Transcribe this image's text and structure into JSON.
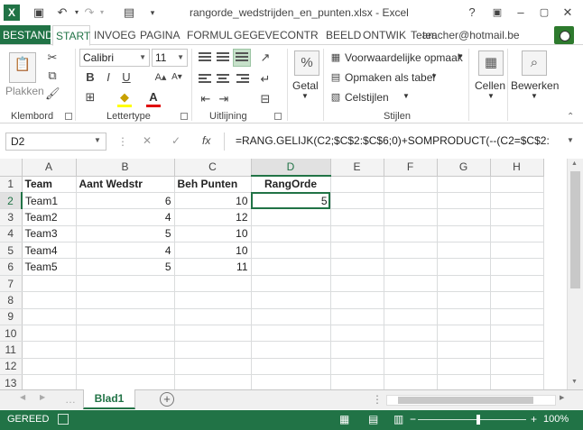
{
  "window": {
    "title": "rangorde_wedstrijden_en_punten.xlsx - Excel",
    "help": "?",
    "minimize": "–",
    "close": "✕"
  },
  "tabs": [
    "BESTAND",
    "START",
    "INVOEG",
    "PAGINA",
    "FORMUL",
    "GEGEVE",
    "CONTR",
    "BEELD",
    "ONTWIK",
    "Team"
  ],
  "account": "teacher@hotmail.be",
  "ribbon": {
    "paste_label": "Plakken",
    "clipboard_label": "Klembord",
    "font_name": "Calibri",
    "font_size": "11",
    "font_label": "Lettertype",
    "bold": "B",
    "italic": "I",
    "underline": "U",
    "alignment_label": "Uitlijning",
    "number_label": "Getal",
    "number_icon_text": "%",
    "cond_format": "Voorwaardelijke opmaak",
    "format_table": "Opmaken als tabel",
    "cell_styles": "Celstijlen",
    "styles_label": "Stijlen",
    "cells_label": "Cellen",
    "edit_label": "Bewerken"
  },
  "formula_bar": {
    "name_box": "D2",
    "cancel": "✕",
    "enter": "✓",
    "fx": "fx",
    "formula": "=RANG.GELIJK(C2;$C$2:$C$6;0)+SOMPRODUCT(--(C2=$C$2:"
  },
  "sheet": {
    "columns": [
      "A",
      "B",
      "C",
      "D",
      "E",
      "F",
      "G",
      "H"
    ],
    "rows": [
      [
        "Team",
        "Aant Wedstr",
        "Beh Punten",
        "RangOrde",
        "",
        "",
        "",
        ""
      ],
      [
        "Team1",
        "6",
        "10",
        "5",
        "",
        "",
        "",
        ""
      ],
      [
        "Team2",
        "4",
        "12",
        "",
        "",
        "",
        "",
        ""
      ],
      [
        "Team3",
        "5",
        "10",
        "",
        "",
        "",
        "",
        ""
      ],
      [
        "Team4",
        "4",
        "10",
        "",
        "",
        "",
        "",
        ""
      ],
      [
        "Team5",
        "5",
        "11",
        "",
        "",
        "",
        "",
        ""
      ],
      [
        "",
        "",
        "",
        "",
        "",
        "",
        "",
        ""
      ],
      [
        "",
        "",
        "",
        "",
        "",
        "",
        "",
        ""
      ],
      [
        "",
        "",
        "",
        "",
        "",
        "",
        "",
        ""
      ],
      [
        "",
        "",
        "",
        "",
        "",
        "",
        "",
        ""
      ],
      [
        "",
        "",
        "",
        "",
        "",
        "",
        "",
        ""
      ],
      [
        "",
        "",
        "",
        "",
        "",
        "",
        "",
        ""
      ],
      [
        "",
        "",
        "",
        "",
        "",
        "",
        "",
        ""
      ]
    ],
    "row_numbers": [
      "1",
      "2",
      "3",
      "4",
      "5",
      "6",
      "7",
      "8",
      "9",
      "10",
      "11",
      "12",
      "13"
    ]
  },
  "sheet_tab": "Blad1",
  "status": {
    "text": "GEREED",
    "zoom": "100%",
    "zoom_minus": "−",
    "zoom_plus": "+"
  }
}
